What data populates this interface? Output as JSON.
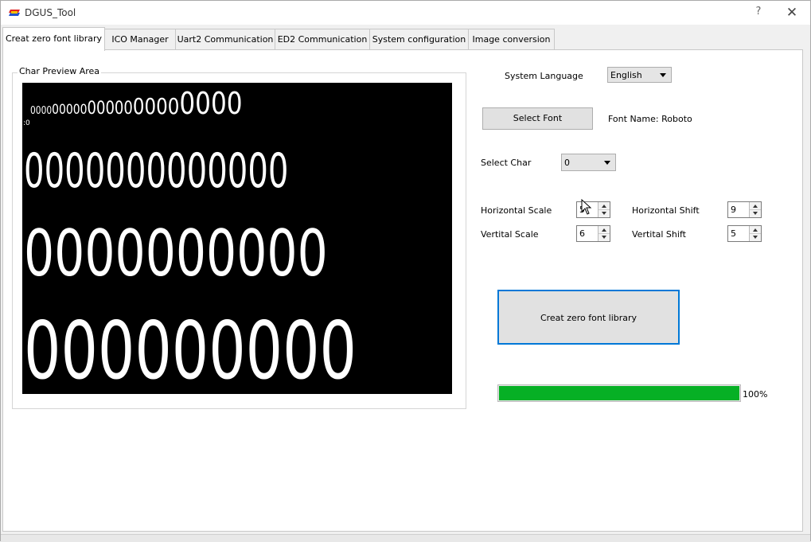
{
  "window": {
    "title": "DGUS_Tool",
    "help_label": "?",
    "close_label": "✕"
  },
  "tabs": [
    {
      "label": "Creat zero font library",
      "active": true
    },
    {
      "label": "ICO Manager",
      "active": false
    },
    {
      "label": "Uart2 Communication",
      "active": false
    },
    {
      "label": "ED2 Communication",
      "active": false
    },
    {
      "label": "System configuration",
      "active": false
    },
    {
      "label": "Image conversion",
      "active": false
    }
  ],
  "preview": {
    "group_label": "Char Preview Area",
    "row0": ":0",
    "row1": "0000000000000000000000",
    "row2": "0000000000000",
    "row3": "0000000000",
    "row4": "000000000"
  },
  "settings": {
    "system_language_label": "System Language",
    "system_language_value": "English",
    "select_font_button": "Select Font",
    "font_name_label": "Font Name: Roboto",
    "select_char_label": "Select Char",
    "select_char_value": "0",
    "horizontal_scale_label": "Horizontal Scale",
    "horizontal_scale_value": "5",
    "vertical_scale_label": "Vertital Scale",
    "vertical_scale_value": "6",
    "horizontal_shift_label": "Horizontal Shift",
    "horizontal_shift_value": "9",
    "vertical_shift_label": "Vertital Shift",
    "vertical_shift_value": "5",
    "create_button": "Creat zero font library"
  },
  "progress": {
    "value": 1.0,
    "label": "100%",
    "color": "#06b025"
  },
  "colors": {
    "preview_bg": "#000000",
    "preview_fg": "#ffffff",
    "accent_border": "#0078d7"
  }
}
